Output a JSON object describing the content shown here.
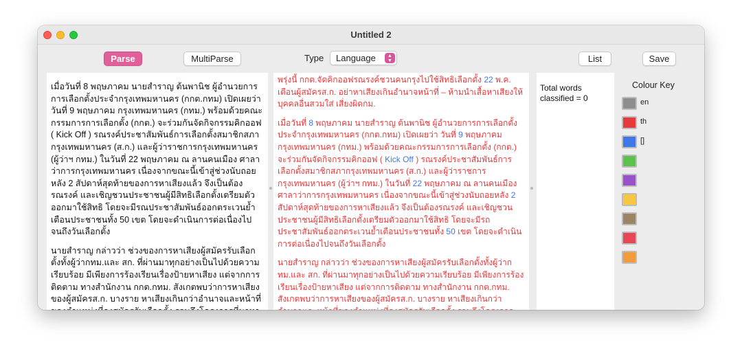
{
  "window": {
    "title": "Untitled 2"
  },
  "toolbar": {
    "parse_label": "Parse",
    "multiparse_label": "MultiParse",
    "type_label": "Type",
    "type_value": "Language",
    "list_label": "List",
    "save_label": "Save"
  },
  "input_text": {
    "paragraphs": [
      "เมื่อวันที่ 8 พฤษภาคม นายสำราญ ต้นพานิช ผู้อำนวยการการเลือกตั้งประจำกรุงเทพมหานคร (กกต.กทม) เปิดเผยว่า วันที่ 9 พฤษภาคม กรุงเทพมหานคร (กทม.) พร้อมด้วยคณะกรรมการการเลือกตั้ง (กกต.) จะร่วมกันจัดกิจกรรมคิกออฟ ( Kick Off ) รณรงค์ประชาสัมพันธ์การเลือกตั้งสมาชิกสภากรุงเทพมหานคร (ส.ก.) และผู้ว่าราชการกรุงเทพมหานคร (ผู้ว่าฯ กทม.) ในวันที่ 22 พฤษภาคม ณ ลานคนเมือง ศาลาว่าการกรุงเทพมหานคร เนื่องจากขณะนี้เข้าสู่ช่วงนับถอยหลัง 2 สัปดาห์สุดท้ายของการหาเสียงแล้ว จึงเป็นต้องรณรงค์ และเชิญชวนประชาชนผู้มีสิทธิเลือกตั้งเตรียมตัวออกมาใช้สิทธิ โดยจะมีรณประชาสัมพันธ์ออกตระเวนย้ำเตือนประชาชนทั้ง 50 เขต โดยจะดำเนินการต่อเนื่องไปจนถึงวันเลือกตั้ง",
      "นายสำราญ กล่าวว่า ช่วงของการหาเสียงผู้สมัครรับเลือกตั้งทั้งผู้ว่ากทม.และ สก. ที่ผ่านมาทุกอย่างเป็นไปด้วยความเรียบร้อย มีเพียงการร้องเรียนเรื่องป้ายหาเสียง แต่จากการติดตาม ทางสำนักงาน กกต.กทม. สังเกตพบว่าการหาเสียงของผู้สมัครส.ก. บางราย หาเสียงเกินกว่าอำนาจและหน้าที่ของตำแหน่งที่ลงสมัครรับเลือกตั้ง รวมถึงโครงการที่มาหาเสียงเกินวงเงินงบประมาณที่กทม.ได้รับ จึงขอเตือนผู้สมัครอย่าได้หาเสียงเกินอำนาจหน้าที่"
    ]
  },
  "output_text": {
    "paragraphs": [
      [
        {
          "t": "พรุ่งนี้ กกต.จัดคิกออฟรณรงค์ชวนคนกรุงไปใช้สิทธิเลือกตั้ง ",
          "c": "th"
        },
        {
          "t": "22",
          "c": "en"
        },
        {
          "t": " พ.ค. เตือนผู้สมัครส.ก. อย่าหาเสียงเกินอำนาจหน้าที่ – ห้ามนำเสื้อหาเสียงให้บุคคลอื่นสวมใส่ เสี่ยงผิดกม.",
          "c": "th"
        }
      ],
      [
        {
          "t": "เมื่อวันที่ ",
          "c": "th"
        },
        {
          "t": "8",
          "c": "en"
        },
        {
          "t": " พฤษภาคม นายสำราญ ต้นพานิช ผู้อำนวยการการเลือกตั้งประจำกรุงเทพมหานคร (กกต.กทม) เปิดเผยว่า วันที่ ",
          "c": "th"
        },
        {
          "t": "9",
          "c": "en"
        },
        {
          "t": " พฤษภาคม กรุงเทพมหานคร (กทม.) พร้อมด้วยคณะกรรมการการเลือกตั้ง (กกต.) จะร่วมกันจัดกิจกรรมคิกออฟ ( ",
          "c": "th"
        },
        {
          "t": "Kick Off",
          "c": "en"
        },
        {
          "t": " ) รณรงค์ประชาสัมพันธ์การเลือกตั้งสมาชิกสภากรุงเทพมหานคร (ส.ก.) และผู้ว่าราชการกรุงเทพมหานคร (ผู้ว่าฯ กทม.) ในวันที่ ",
          "c": "th"
        },
        {
          "t": "22",
          "c": "en"
        },
        {
          "t": " พฤษภาคม ณ ลานคนเมือง ศาลาว่าการกรุงเทพมหานคร เนื่องจากขณะนี้เข้าสู่ช่วงนับถอยหลัง ",
          "c": "th"
        },
        {
          "t": "2",
          "c": "en"
        },
        {
          "t": " สัปดาห์สุดท้ายของการหาเสียงแล้ว จึงเป็นต้องรณรงค์ และเชิญชวนประชาชนผู้มีสิทธิเลือกตั้งเตรียมตัวออกมาใช้สิทธิ โดยจะมีรถประชาสัมพันธ์ออกตระเวนย้ำเตือนประชาชนทั้ง ",
          "c": "th"
        },
        {
          "t": "50",
          "c": "en"
        },
        {
          "t": " เขต โดยจะดำเนินการต่อเนื่องไปจนถึงวันเลือกตั้ง",
          "c": "th"
        }
      ],
      [
        {
          "t": "นายสำราญ กล่าวว่า ช่วงของการหาเสียงผู้สมัครรับเลือกตั้งทั้งผู้ว่ากทม.และ สก. ที่ผ่านมาทุกอย่างเป็นไปด้วยความเรียบร้อย มีเพียงการร้องเรียนเรื่องป้ายหาเสียง แต่จากการติดตาม ทางสำนักงาน กกต.กทม. สังเกตพบว่าการหาเสียงของผู้สมัครส.ก. บางราย หาเสียงเกินกว่าอำนาจและหน้าที่ของตำแหน่งที่ลงสมัครรับเลือกตั้ง รวมถึงโครงการที่มาหาเสียงเกินวงเงินงบประมาณที่กทม.ได้รับ จึงขอเตือนผู้สมัครอย่าได้หาเสียงเกินอำนาจหน้าที่ตำแหน่งที่ลง",
          "c": "th"
        }
      ]
    ]
  },
  "stats": {
    "total_words_text": "Total words classified = 0"
  },
  "colour_key": {
    "title": "Colour Key",
    "items": [
      {
        "color": "#8e8e8e",
        "label": "en"
      },
      {
        "color": "#e5393b",
        "label": "th"
      },
      {
        "color": "#3f78e6",
        "label": "[]"
      },
      {
        "color": "#5ec04f",
        "label": ""
      },
      {
        "color": "#9a52c8",
        "label": ""
      },
      {
        "color": "#f7c742",
        "label": ""
      },
      {
        "color": "#9c8467",
        "label": ""
      },
      {
        "color": "#e84557",
        "label": ""
      },
      {
        "color": "#f29b3a",
        "label": ""
      }
    ]
  }
}
